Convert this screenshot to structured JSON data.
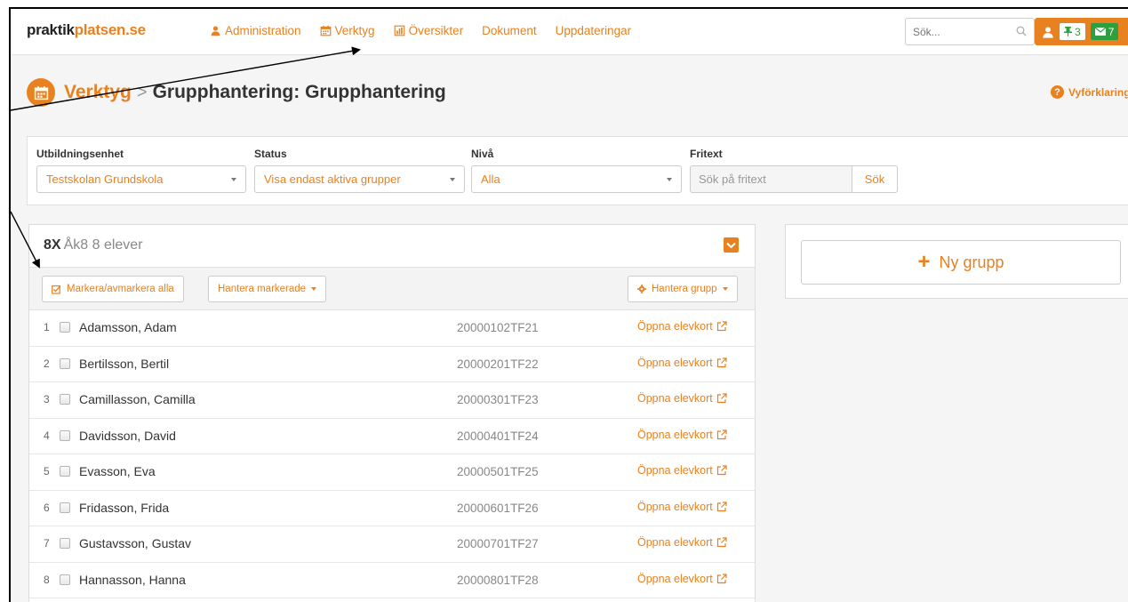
{
  "brand": {
    "part1": "praktik",
    "part2": "platsen.se"
  },
  "nav": [
    {
      "label": "Administration",
      "icon": "user-icon"
    },
    {
      "label": "Verktyg",
      "icon": "calendar-icon"
    },
    {
      "label": "Översikter",
      "icon": "bar-chart-icon"
    },
    {
      "label": "Dokument",
      "icon": ""
    },
    {
      "label": "Uppdateringar",
      "icon": ""
    }
  ],
  "search": {
    "placeholder": "Sök..."
  },
  "user": {
    "pins": "3",
    "messages": "7"
  },
  "header": {
    "crumb1": "Verktyg",
    "sep": ">",
    "crumb2": "Grupphantering: Grupphantering",
    "help": "Vyförklaring"
  },
  "filters": {
    "unit_label": "Utbildningsenhet",
    "unit_value": "Testskolan Grundskola",
    "status_label": "Status",
    "status_value": "Visa endast aktiva grupper",
    "level_label": "Nivå",
    "level_value": "Alla",
    "text_label": "Fritext",
    "text_placeholder": "Sök på fritext",
    "search_button": "Sök"
  },
  "group": {
    "code": "8X",
    "subtitle": "Åk8 8 elever",
    "toggle_all": "Markera/avmarkera alla",
    "manage_selected": "Hantera markerade",
    "manage_group": "Hantera grupp",
    "open_label": "Öppna elevkort",
    "students": [
      {
        "num": "1",
        "name": "Adamsson, Adam",
        "id": "20000102TF21"
      },
      {
        "num": "2",
        "name": "Bertilsson, Bertil",
        "id": "20000201TF22"
      },
      {
        "num": "3",
        "name": "Camillasson, Camilla",
        "id": "20000301TF23"
      },
      {
        "num": "4",
        "name": "Davidsson, David",
        "id": "20000401TF24"
      },
      {
        "num": "5",
        "name": "Evasson, Eva",
        "id": "20000501TF25"
      },
      {
        "num": "6",
        "name": "Fridasson, Frida",
        "id": "20000601TF26"
      },
      {
        "num": "7",
        "name": "Gustavsson, Gustav",
        "id": "20000701TF27"
      },
      {
        "num": "8",
        "name": "Hannasson, Hanna",
        "id": "20000801TF28"
      }
    ]
  },
  "new_group": {
    "label": "Ny grupp"
  },
  "colors": {
    "accent": "#e8811f",
    "green": "#2e9e3e"
  }
}
